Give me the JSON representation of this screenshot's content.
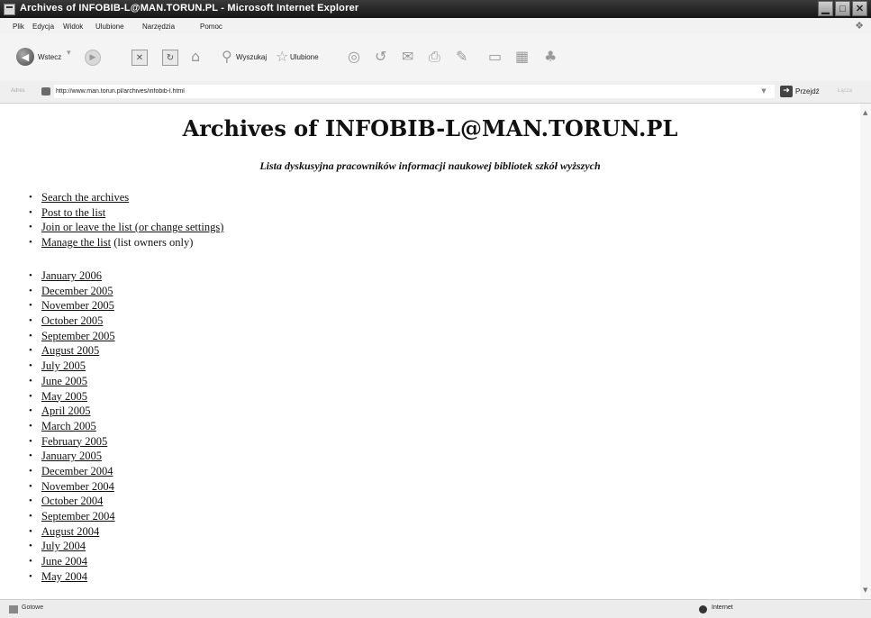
{
  "window": {
    "title": "Archives of INFOBIB-L@MAN.TORUN.PL - Microsoft Internet Explorer"
  },
  "menu": [
    "Plik",
    "Edycja",
    "Widok",
    "Ulubione",
    "Narzędzia",
    "Pomoc"
  ],
  "toolbar": {
    "back_label": "Wstecz",
    "search_label": "Wyszukaj",
    "favorites_label": "Ulubione"
  },
  "address": {
    "label": "Adres",
    "url": "http://www.man.torun.pl/archives/infobib-l.html",
    "go_label": "Przejdź",
    "links_label": "Łącza"
  },
  "page": {
    "title": "Archives of INFOBIB-L@MAN.TORUN.PL",
    "subtitle": "Lista dyskusyjna pracowników informacji naukowej bibliotek szkół wyższych",
    "actions": [
      {
        "link": "Search the archives",
        "suffix": ""
      },
      {
        "link": "Post to the list",
        "suffix": ""
      },
      {
        "link": "Join or leave the list (or change settings)",
        "suffix": ""
      },
      {
        "link": "Manage the list",
        "suffix": " (list owners only)"
      }
    ],
    "months": [
      "January 2006",
      "December 2005",
      "November 2005",
      "October 2005",
      "September 2005",
      "August 2005",
      "July 2005",
      "June 2005",
      "May 2005",
      "April 2005",
      "March 2005",
      "February 2005",
      "January 2005",
      "December 2004",
      "November 2004",
      "October 2004",
      "September 2004",
      "August 2004",
      "July 2004",
      "June 2004",
      "May 2004"
    ]
  },
  "status": {
    "text": "Gotowe",
    "zone": "Internet"
  }
}
